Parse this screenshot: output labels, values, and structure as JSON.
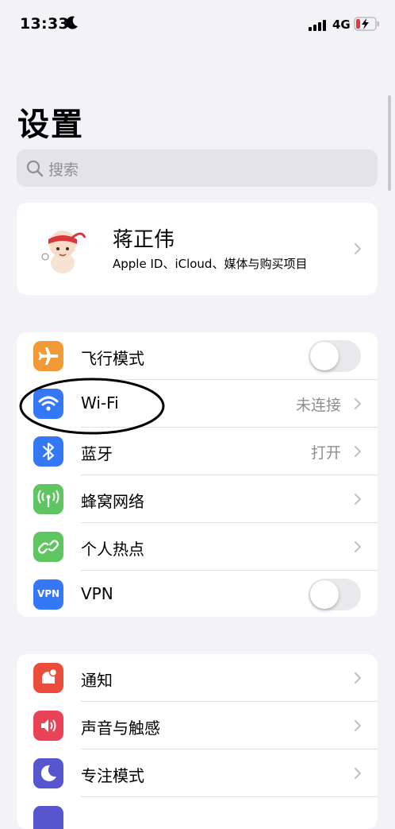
{
  "status_bar": {
    "time": "13:33",
    "network": "4G"
  },
  "title": "设置",
  "search": {
    "placeholder": "搜索"
  },
  "profile": {
    "name": "蒋正伟",
    "subtitle": "Apple ID、iCloud、媒体与购买项目"
  },
  "connectivity": [
    {
      "icon": "airplane-icon",
      "label": "飞行模式",
      "control": "toggle",
      "toggle_on": false,
      "color": "#f29a38"
    },
    {
      "icon": "wifi-icon",
      "label": "Wi-Fi",
      "value": "未连接",
      "control": "chevron",
      "color": "#3478f6"
    },
    {
      "icon": "bluetooth-icon",
      "label": "蓝牙",
      "value": "打开",
      "control": "chevron",
      "color": "#3478f6"
    },
    {
      "icon": "cellular-icon",
      "label": "蜂窝网络",
      "control": "chevron",
      "color": "#5fc561"
    },
    {
      "icon": "hotspot-icon",
      "label": "个人热点",
      "control": "chevron",
      "color": "#5fc561"
    },
    {
      "icon": "vpn-icon",
      "icon_text": "VPN",
      "label": "VPN",
      "control": "toggle",
      "toggle_on": false,
      "color": "#3478f6"
    }
  ],
  "notifications": [
    {
      "icon": "notification-icon",
      "label": "通知",
      "color": "#eb4d3d"
    },
    {
      "icon": "sound-icon",
      "label": "声音与触感",
      "color": "#e9435a"
    },
    {
      "icon": "focus-moon-icon",
      "label": "专注模式",
      "color": "#5756ce"
    }
  ]
}
